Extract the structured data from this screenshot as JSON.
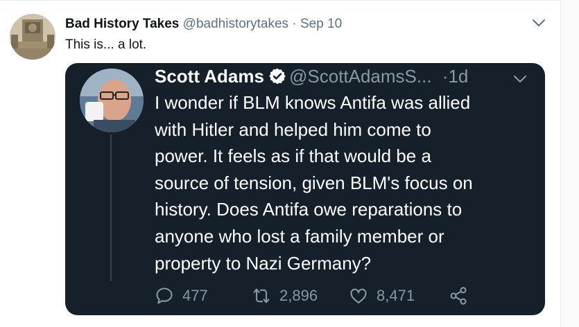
{
  "tweet": {
    "author_name": "Bad History Takes",
    "author_handle": "@badhistorytakes",
    "separator": "·",
    "date": "Sep 10",
    "text": "This is... a lot."
  },
  "quoted": {
    "author_name": "Scott Adams",
    "author_handle": "@ScottAdamsS...",
    "separator": "·",
    "time": "1d",
    "lines": [
      "I wonder if BLM knows Antifa was allied",
      "with Hitler and helped him come to",
      "power. It feels as if that would be a",
      "source of tension, given BLM's focus on",
      "history. Does Antifa owe reparations to",
      "anyone who lost a family member or",
      "property to Nazi Germany?"
    ],
    "replies": "477",
    "retweets": "2,896",
    "likes": "8,471"
  },
  "colors": {
    "card_bg": "#15202b",
    "muted": "#8899a6",
    "verified": "#ffffff"
  },
  "icons": [
    "chevron-down-icon",
    "verified-badge-icon",
    "reply-icon",
    "retweet-icon",
    "like-icon",
    "share-icon"
  ]
}
